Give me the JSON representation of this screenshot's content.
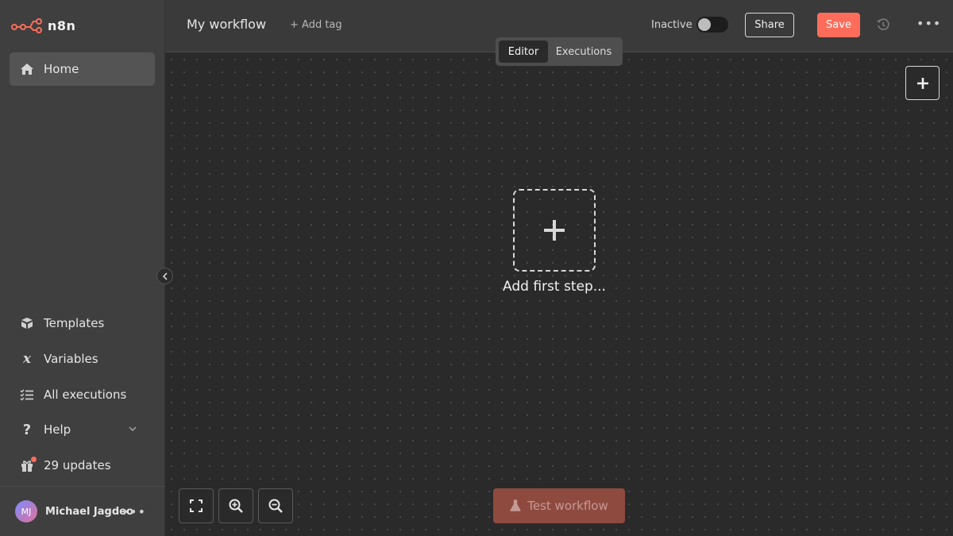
{
  "brand": {
    "name": "n8n",
    "accent": "#ff6d5a"
  },
  "sidebar": {
    "home": {
      "label": "Home",
      "icon": "home-icon"
    },
    "items": [
      {
        "label": "Templates",
        "icon": "box-icon"
      },
      {
        "label": "Variables",
        "icon": "variable-x-icon"
      },
      {
        "label": "All executions",
        "icon": "tasks-list-icon"
      },
      {
        "label": "Help",
        "icon": "question-icon"
      },
      {
        "label": "29 updates",
        "icon": "gift-icon"
      }
    ],
    "user": {
      "initials": "MJ",
      "name": "Michael Jagdeo",
      "menu": "•••"
    }
  },
  "header": {
    "workflow_name": "My workflow",
    "add_tag": "+ Add tag",
    "status_label": "Inactive",
    "share_label": "Share",
    "save_label": "Save",
    "more_label": "•••"
  },
  "tabs": {
    "editor": "Editor",
    "executions": "Executions"
  },
  "canvas": {
    "first_step_label": "Add first step...",
    "test_workflow_label": "Test workflow"
  }
}
